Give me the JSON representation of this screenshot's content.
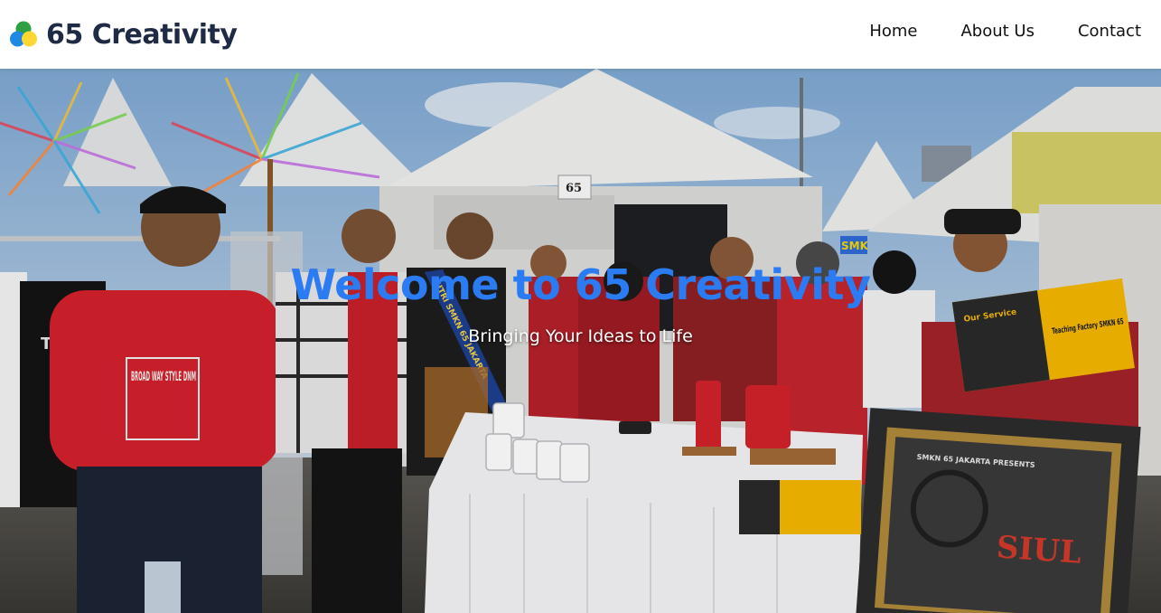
{
  "brand": {
    "name": "65 Creativity",
    "logo_icon": "tri-color-circles-logo-icon",
    "logo_colors": [
      "#2ea043",
      "#1e88e5",
      "#fdd835"
    ]
  },
  "nav": {
    "links": [
      {
        "label": "Home"
      },
      {
        "label": "About Us"
      },
      {
        "label": "Contact"
      }
    ]
  },
  "hero": {
    "title": "Welcome to 65 Creativity",
    "subtitle": "Bringing Your Ideas to Life",
    "title_color": "#2b7bf2"
  },
  "photo": {
    "booth_number": "65",
    "shirt_text": "BROAD WAY STYLE DNM",
    "sash_text": "PUTRI SMKN 65 JAKARTA",
    "flyer_heading": "Teaching Factory SMKN 65",
    "flyer_sub": "Our Service",
    "poster_header": "SMKN 65 JAKARTA PRESENTS",
    "poster_title": "SIUL",
    "banner_partial": "SMK"
  }
}
